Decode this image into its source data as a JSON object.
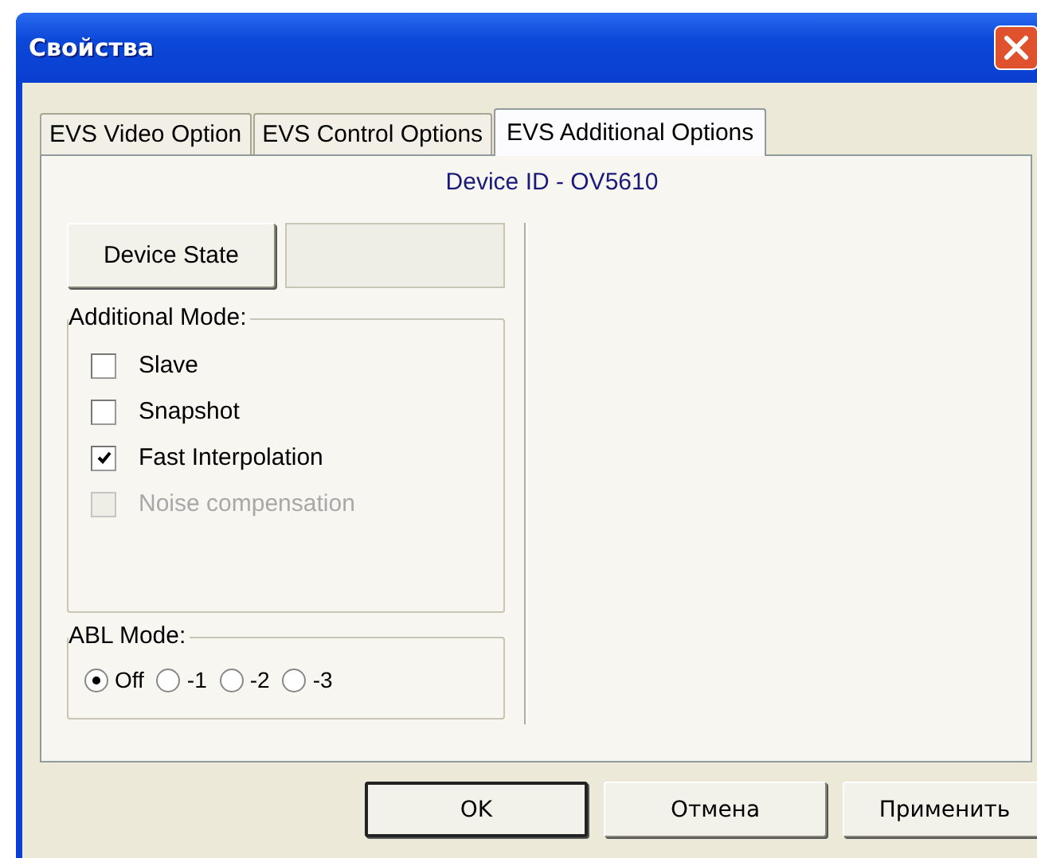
{
  "window": {
    "title": "Свойства"
  },
  "tabs": [
    {
      "label": "EVS Video Option",
      "selected": false
    },
    {
      "label": "EVS Control Options",
      "selected": false
    },
    {
      "label": "EVS Additional Options",
      "selected": true
    }
  ],
  "device_id": "Device ID - OV5610",
  "device_state": {
    "button": "Device State"
  },
  "additional_mode": {
    "title": "Additional Mode:",
    "options": [
      {
        "label": "Slave",
        "checked": false,
        "disabled": false
      },
      {
        "label": "Snapshot",
        "checked": false,
        "disabled": false
      },
      {
        "label": "Fast Interpolation",
        "checked": true,
        "disabled": false
      },
      {
        "label": "Noise compensation",
        "checked": false,
        "disabled": true
      }
    ]
  },
  "abl_mode": {
    "title": "ABL Mode:",
    "options": [
      {
        "label": "Off",
        "selected": true
      },
      {
        "label": "-1",
        "selected": false
      },
      {
        "label": "-2",
        "selected": false
      },
      {
        "label": "-3",
        "selected": false
      }
    ]
  },
  "buttons": [
    {
      "label": "OK",
      "default": true
    },
    {
      "label": "Отмена",
      "default": false
    },
    {
      "label": "Применить",
      "default": false
    }
  ]
}
